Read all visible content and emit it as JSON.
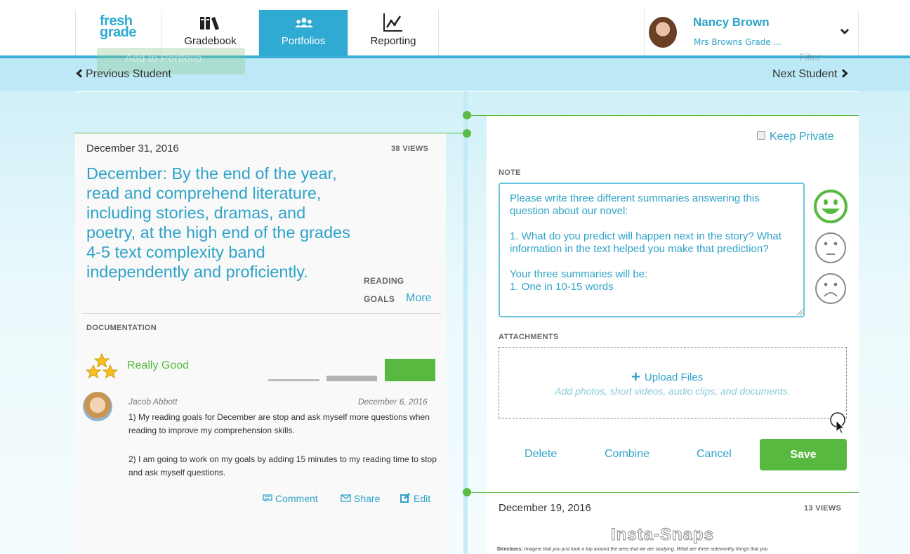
{
  "nav": {
    "logo_line1": "fresh",
    "logo_line2": "grade",
    "tabs": [
      {
        "label": "Gradebook",
        "icon": "books-icon"
      },
      {
        "label": "Portfolios",
        "icon": "people-icon"
      },
      {
        "label": "Reporting",
        "icon": "chart-icon"
      }
    ],
    "active_tab": "Portfolios",
    "user_name": "Nancy Brown",
    "user_class": "Mrs Browns Grade ..."
  },
  "subbar": {
    "ghost_button": "Add to Portfolio",
    "ghost_filter": "Filter",
    "prev_student": "Previous Student",
    "next_student": "Next Student"
  },
  "left_card": {
    "date": "December 31, 2016",
    "views": "38 VIEWS",
    "goal": "December: By the end of the year, read and comprehend literature, including stories, dramas, and poetry, at the high end of the grades 4-5 text complexity band independently and proficiently.",
    "tag_line1": "READING",
    "tag_line2": "GOALS",
    "more_link": "More",
    "documentation_label": "DOCUMENTATION",
    "rating_label": "Really Good",
    "rating_level": 3,
    "rating_max": 3,
    "entry": {
      "author": "Jacob Abbott",
      "date": "December 6, 2016",
      "paragraph1": "1) My reading goals for December are stop and ask myself more questions when reading to improve my comprehension skills.",
      "paragraph2": "2) I am going to work on my goals by adding 15 minutes to my reading time to stop and ask myself questions."
    },
    "actions": {
      "comment": "Comment",
      "share": "Share",
      "edit": "Edit"
    }
  },
  "right_card": {
    "keep_private_label": "Keep Private",
    "keep_private_checked": false,
    "note_label": "NOTE",
    "note_text": "Please write three different summaries answering this question about our novel:\n\n1. What do you predict will happen next in the story? What information in the text helped you make that prediction?\n\nYour three summaries will be:\n1. One in 10-15 words",
    "selected_face": "happy",
    "attachments_label": "ATTACHMENTS",
    "upload_label": "Upload Files",
    "upload_hint": "Add photos, short videos, audio clips, and documents.",
    "buttons": {
      "delete": "Delete",
      "combine": "Combine",
      "cancel": "Cancel",
      "save": "Save"
    }
  },
  "next_card": {
    "date": "December 19, 2016",
    "views": "13 VIEWS",
    "image_title": "Insta-Snaps",
    "image_caption_label": "Directions:",
    "image_caption": "Imagine that you just took a trip around the area that we are studying. What are three noteworthy things that you"
  },
  "colors": {
    "brand_blue": "#2eaad3",
    "link_blue": "#2ea3c8",
    "green": "#58b940",
    "timeline_green": "#5bbb47"
  }
}
